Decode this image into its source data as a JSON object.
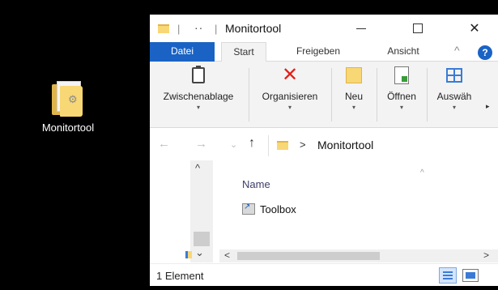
{
  "desktop": {
    "icon_label": "Monitortool"
  },
  "window": {
    "title": "Monitortool",
    "quick_access_dots": "··",
    "quick_access_separator": "|",
    "controls": {
      "minimize": "—",
      "maximize": "☐",
      "close": "✕"
    }
  },
  "ribbon": {
    "tabs": [
      "Datei",
      "Start",
      "Freigeben",
      "Ansicht"
    ],
    "active_tab": "Start",
    "collapse_caret": "^",
    "help": "?",
    "groups": [
      {
        "label": "Zwischenablage",
        "icon": "clipboard-icon"
      },
      {
        "label": "Organisieren",
        "icon": "delete-x-icon"
      },
      {
        "label": "Neu",
        "icon": "new-folder-icon"
      },
      {
        "label": "Öffnen",
        "icon": "open-icon"
      },
      {
        "label": "Auswäh",
        "icon": "select-icon"
      }
    ],
    "group_arrow": "▾",
    "more_arrow": "▸"
  },
  "address": {
    "back": "←",
    "forward": "→",
    "history": "⌄",
    "up": "↑",
    "chevron": ">",
    "path": "Monitortool"
  },
  "content": {
    "column_header": "Name",
    "sort_caret": "^",
    "files": [
      {
        "name": "Toolbox",
        "icon": "shortcut-icon"
      }
    ],
    "vscroll_up": "^",
    "vscroll_down": "⌄",
    "hscroll_left": "<",
    "hscroll_right": ">"
  },
  "status": {
    "count_text": "1 Element"
  },
  "colors": {
    "accent": "#1a63c5",
    "folder": "#f8d775",
    "delete_red": "#e0201b"
  }
}
